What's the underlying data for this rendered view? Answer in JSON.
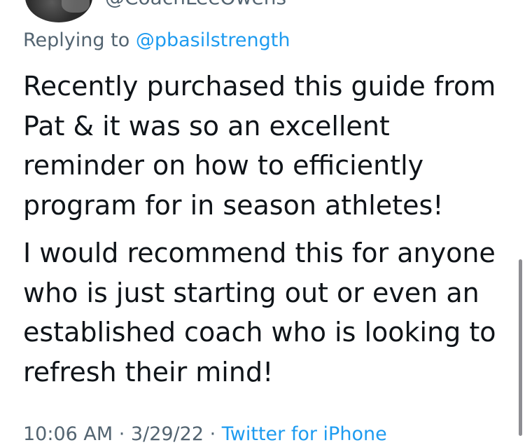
{
  "author": {
    "handle": "@CoachLeeOwens"
  },
  "reply": {
    "prefix": "Replying to ",
    "mention": "@pbasilstrength"
  },
  "tweet": {
    "paragraphs": [
      "Recently purchased this guide from Pat & it was so an excellent reminder on how to efficiently program for in season athletes!",
      "I would recommend this for anyone who is just starting out or even an established coach who is looking to refresh their mind!"
    ]
  },
  "meta": {
    "time": "10:06 AM",
    "separator_1": " · ",
    "date": "3/29/22",
    "separator_2": " · ",
    "source": "Twitter for iPhone"
  },
  "colors": {
    "text": "#0f1419",
    "secondary": "#536471",
    "link": "#1d9bf0"
  }
}
